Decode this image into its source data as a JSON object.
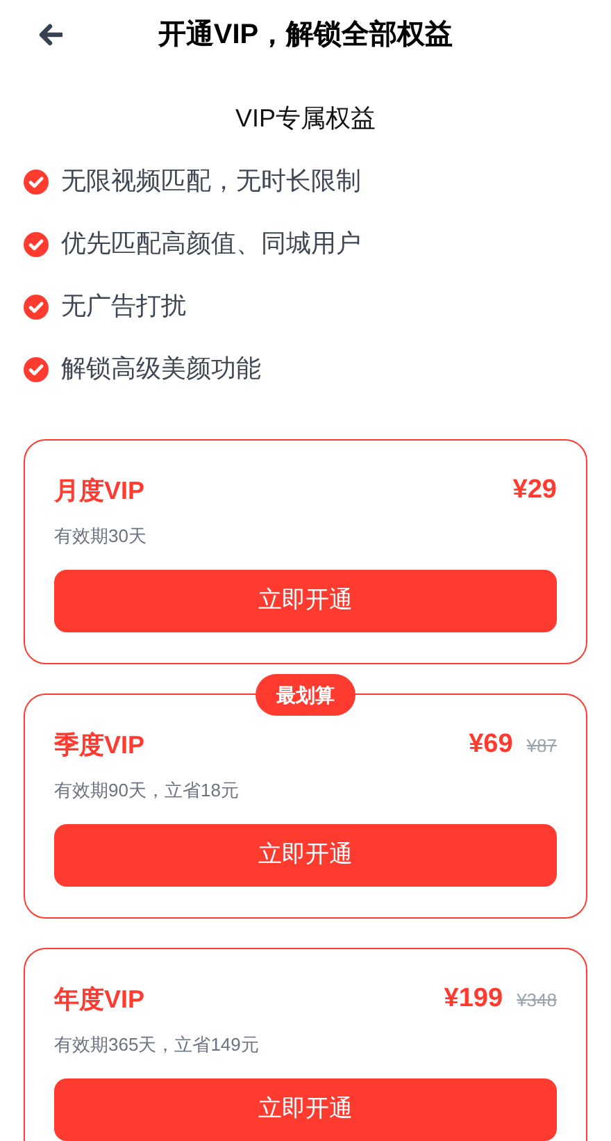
{
  "header": {
    "title": "开通VIP，解锁全部权益"
  },
  "benefits_title": "VIP专属权益",
  "benefits": [
    "无限视频匹配，无时长限制",
    "优先匹配高颜值、同城用户",
    "无广告打扰",
    "解锁高级美颜功能"
  ],
  "plans": [
    {
      "name": "月度VIP",
      "price": "¥29",
      "validity": "有效期30天",
      "button": "立即开通"
    },
    {
      "name": "季度VIP",
      "price": "¥69",
      "original_price": "¥87",
      "validity": "有效期90天，立省18元",
      "button": "立即开通",
      "badge": "最划算"
    },
    {
      "name": "年度VIP",
      "price": "¥199",
      "original_price": "¥348",
      "validity": "有效期365天，立省149元",
      "button": "立即开通"
    }
  ]
}
